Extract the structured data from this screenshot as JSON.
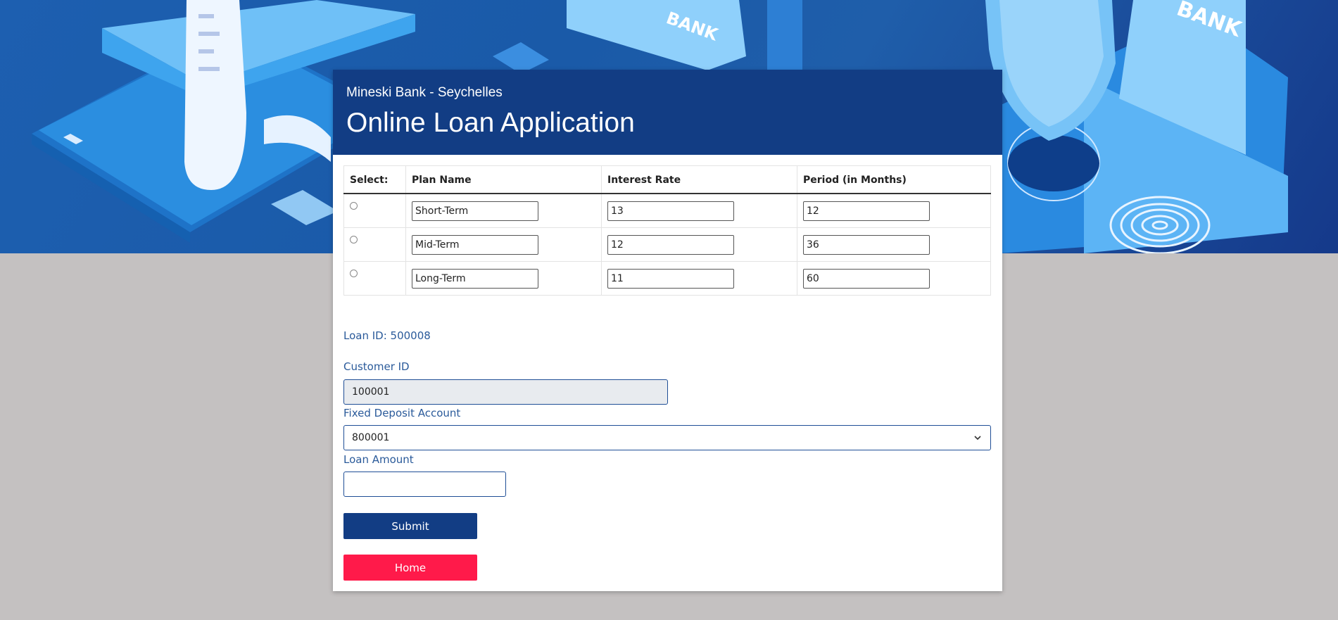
{
  "header": {
    "brand": "Mineski Bank - Seychelles",
    "title": "Online Loan Application"
  },
  "plans": {
    "columns": [
      "Select:",
      "Plan Name",
      "Interest Rate",
      "Period (in Months)"
    ],
    "rows": [
      {
        "name": "Short-Term",
        "rate": "13",
        "period": "12"
      },
      {
        "name": "Mid-Term",
        "rate": "12",
        "period": "36"
      },
      {
        "name": "Long-Term",
        "rate": "11",
        "period": "60"
      }
    ]
  },
  "form": {
    "loan_id": "Loan ID: 500008",
    "customer_label": "Customer ID",
    "customer_value": "100001",
    "fd_label": "Fixed Deposit Account",
    "fd_value": "800001",
    "amount_label": "Loan Amount",
    "amount_value": "",
    "submit_label": "Submit",
    "home_label": "Home"
  },
  "hero_text": {
    "bank_left": "BANK",
    "bank_right": "BANK"
  },
  "colors": {
    "header_bg": "#123d84",
    "submit_bg": "#123d84",
    "home_bg": "#ff1a4a",
    "label": "#2a5a9a"
  }
}
